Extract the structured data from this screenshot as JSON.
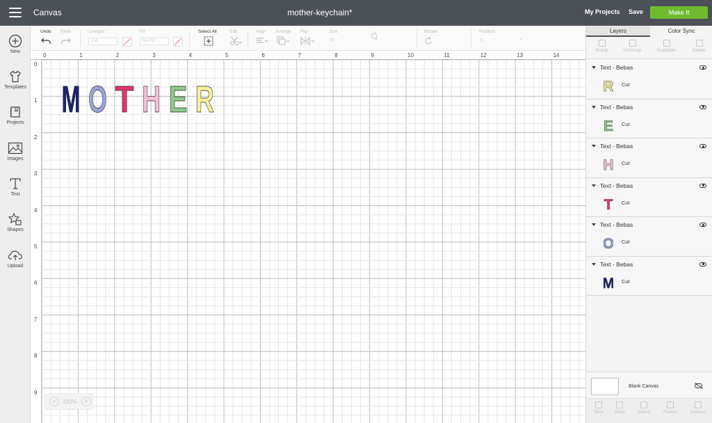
{
  "header": {
    "menu_icon": "hamburger-menu-icon",
    "app_title": "Canvas",
    "project_name": "mother-keychain*",
    "my_projects": "My Projects",
    "save": "Save",
    "make_it": "Make It",
    "make_it_color": "#6fbb2e",
    "bar_color": "#4b5157"
  },
  "sidebar": {
    "items": [
      {
        "label": "New",
        "icon": "plus-circle-icon"
      },
      {
        "label": "Templates",
        "icon": "tshirt-icon"
      },
      {
        "label": "Projects",
        "icon": "projects-icon"
      },
      {
        "label": "Images",
        "icon": "image-icon"
      },
      {
        "label": "Text",
        "icon": "text-icon"
      },
      {
        "label": "Shapes",
        "icon": "shapes-icon"
      },
      {
        "label": "Upload",
        "icon": "upload-cloud-icon"
      }
    ]
  },
  "toolbar": {
    "undo": "Undo",
    "redo": "Redo",
    "linetype": "Linetype",
    "linetype_value": "Cut",
    "fill": "Fill",
    "fill_value": "No Fill",
    "select_all": "Select All",
    "edit": "Edit",
    "align": "Align",
    "arrange": "Arrange",
    "flip": "Flip",
    "size": "Size",
    "w": "W",
    "h": "H",
    "rotate": "Rotate",
    "position": "Position",
    "x": "X",
    "y": "Y"
  },
  "canvas": {
    "ruler_top": [
      "0",
      "1",
      "2",
      "3",
      "4",
      "5",
      "6",
      "7",
      "8",
      "9",
      "10",
      "11",
      "12",
      "13",
      "14"
    ],
    "ruler_left": [
      "0",
      "1",
      "2",
      "3",
      "4",
      "5",
      "6",
      "7",
      "8",
      "9"
    ],
    "zoom": "100%",
    "design_letters": [
      {
        "char": "M",
        "color": "#1c2470"
      },
      {
        "char": "O",
        "color": "#9aa3d6"
      },
      {
        "char": "T",
        "color": "#e2346c"
      },
      {
        "char": "H",
        "color": "#f4bfd6"
      },
      {
        "char": "E",
        "color": "#8fc98c"
      },
      {
        "char": "R",
        "color": "#f6f09a"
      }
    ]
  },
  "right_panel": {
    "tabs": [
      "Layers",
      "Color Sync"
    ],
    "tools": [
      "Group",
      "UnGroup",
      "Duplicate",
      "Delete"
    ],
    "layers": [
      {
        "name": "Text - Bebas",
        "letter": "R",
        "color": "#f6f09a",
        "op": "Cut"
      },
      {
        "name": "Text - Bebas",
        "letter": "E",
        "color": "#8fc98c",
        "op": "Cut"
      },
      {
        "name": "Text - Bebas",
        "letter": "H",
        "color": "#f4bfd6",
        "op": "Cut"
      },
      {
        "name": "Text - Bebas",
        "letter": "T",
        "color": "#e2346c",
        "op": "Cut"
      },
      {
        "name": "Text - Bebas",
        "letter": "O",
        "color": "#9aa3d6",
        "op": "Cut"
      },
      {
        "name": "Text - Bebas",
        "letter": "M",
        "color": "#1c2470",
        "op": "Cut"
      }
    ],
    "blank_canvas": "Blank Canvas",
    "bottom_tools": [
      "Slice",
      "Weld",
      "Attach",
      "Flatten",
      "Contour"
    ]
  }
}
